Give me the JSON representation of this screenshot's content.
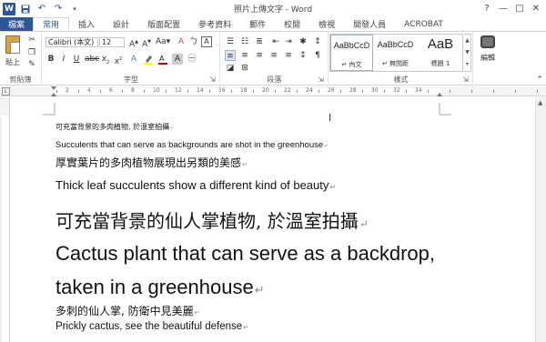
{
  "window": {
    "title": "照片上傳文字 - Word",
    "app_icon": "W",
    "controls": [
      "?",
      "—",
      "□",
      "✕"
    ]
  },
  "quick_access": [
    "save-icon",
    "undo-icon",
    "redo-icon"
  ],
  "tabs": [
    {
      "label": "檔案"
    },
    {
      "label": "常用"
    },
    {
      "label": "插入"
    },
    {
      "label": "設計"
    },
    {
      "label": "版面配置"
    },
    {
      "label": "參考資料"
    },
    {
      "label": "郵件"
    },
    {
      "label": "校閱"
    },
    {
      "label": "檢視"
    },
    {
      "label": "開發人員"
    },
    {
      "label": "ACROBAT"
    }
  ],
  "ribbon": {
    "clipboard": {
      "paste_label": "貼上",
      "group_label": "剪貼簿"
    },
    "font": {
      "font_name": "Calibri (本文)",
      "font_size": "12",
      "group_label": "字型"
    },
    "paragraph": {
      "group_label": "段落"
    },
    "styles": {
      "items": [
        {
          "sample": "AaBbCcD",
          "name": "↵ 內文"
        },
        {
          "sample": "AaBbCcD",
          "name": "↵ 無間距"
        },
        {
          "sample": "AaB",
          "name": "標題 1"
        }
      ],
      "group_label": "樣式"
    },
    "editing": {
      "label": "編輯"
    }
  },
  "document": {
    "lines": [
      "可充當背景的多肉植物, 於溫室拍攝",
      "Succulents that can serve as backgrounds are shot in the greenhouse",
      "厚實葉片的多肉植物展現出另類的美感",
      "Thick leaf succulents show a different kind of beauty",
      "可充當背景的仙人掌植物, 於溫室拍攝",
      "Cactus plant that can serve as a backdrop,",
      "taken in a greenhouse",
      "多刺的仙人掌, 防衛中見美麗",
      "Prickly cactus, see the beautiful defense"
    ],
    "paragraph_mark": "↵"
  },
  "colors": {
    "accent": "#2b579a"
  }
}
